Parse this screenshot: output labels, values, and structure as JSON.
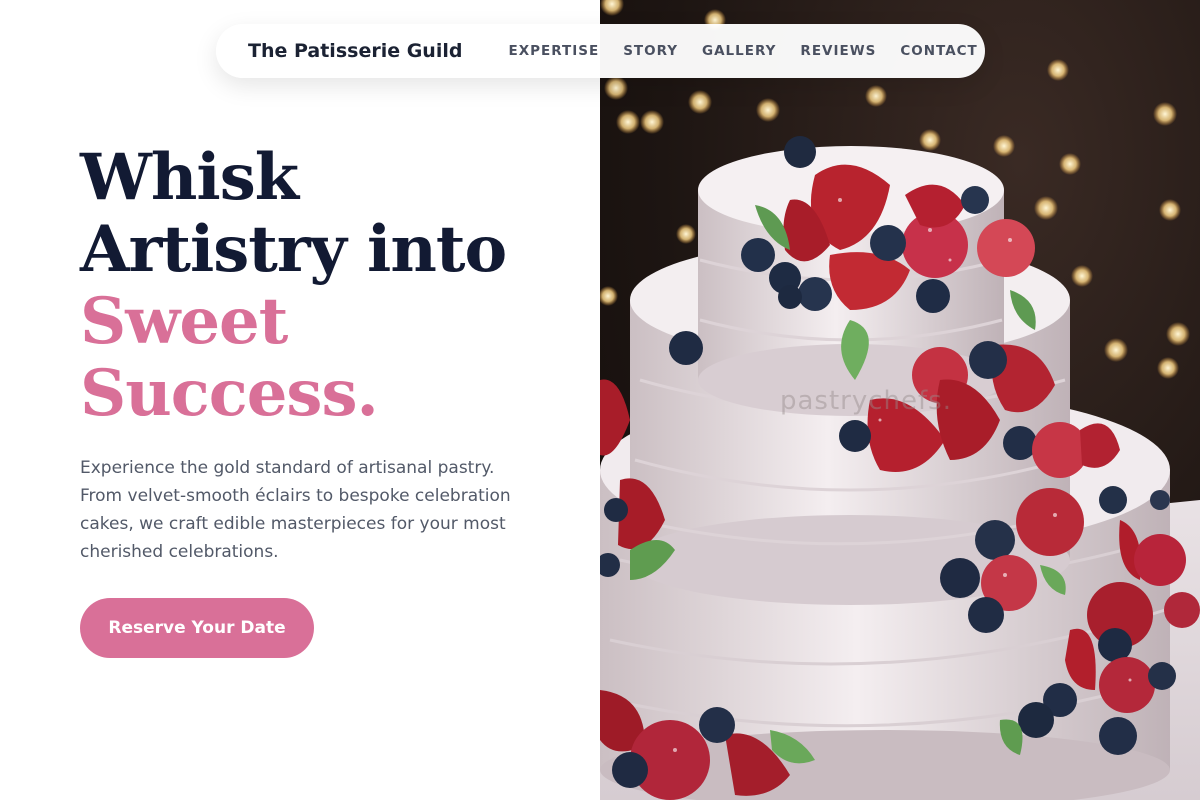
{
  "nav": {
    "brand": "The Patisserie Guild",
    "links": [
      "EXPERTISE",
      "STORY",
      "GALLERY",
      "REVIEWS",
      "CONTACT"
    ]
  },
  "hero": {
    "title_dark_1": "Whisk",
    "title_dark_2": "Artistry into",
    "title_pink_1": "Sweet",
    "title_pink_2": "Success.",
    "description": "Experience the gold standard of artisanal pastry. From velvet-smooth éclairs to bespoke celebration cakes, we craft edible masterpieces for your most cherished celebrations.",
    "cta_label": "Reserve Your Date"
  },
  "image": {
    "watermark": "pastrychefs."
  },
  "colors": {
    "accent": "#d97098",
    "heading": "#121a33",
    "body_text": "#525968"
  }
}
